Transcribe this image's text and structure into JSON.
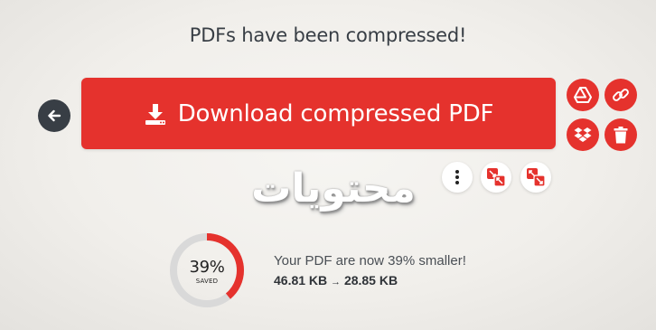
{
  "header": {
    "title": "PDFs have been compressed!"
  },
  "actions": {
    "download_label": "Download compressed PDF",
    "back_icon": "arrow-left-icon",
    "google_drive_icon": "google-drive-icon",
    "link_icon": "link-icon",
    "dropbox_icon": "dropbox-icon",
    "delete_icon": "trash-icon",
    "more_icon": "vertical-dots-icon",
    "tool_icon_1": "compress-icon",
    "tool_icon_2": "expand-icon"
  },
  "watermark": {
    "text": "محتويات"
  },
  "result": {
    "percent_label": "39%",
    "percent_value": 39,
    "saved_label": "SAVED",
    "message": "Your PDF are now 39% smaller!",
    "original_size": "46.81 KB",
    "arrow": "→",
    "new_size": "28.85 KB"
  },
  "colors": {
    "accent": "#e5322d",
    "dark": "#383e45",
    "gauge_track": "#d9d9d9"
  }
}
